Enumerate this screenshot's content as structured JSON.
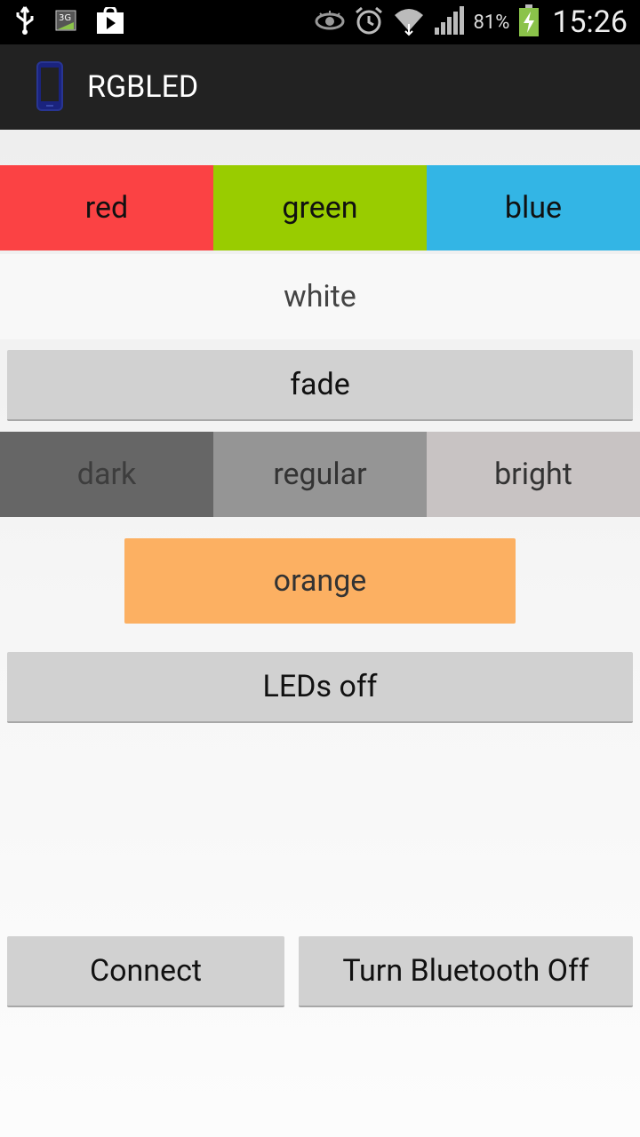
{
  "status_bar": {
    "battery_percent": "81%",
    "time": "15:26",
    "icons": [
      "usb-icon",
      "3g-icon",
      "play-store-icon",
      "eye-icon",
      "alarm-icon",
      "wifi-icon",
      "signal-icon",
      "battery-charging-icon"
    ]
  },
  "action_bar": {
    "title": "RGBLED",
    "icon": "phone-icon"
  },
  "colors": {
    "red": "#fb4244",
    "green": "#99cc00",
    "blue": "#33b5e5",
    "white": "#f8f8f8",
    "dark": "#666666",
    "regular": "#959595",
    "bright": "#c8c3c3",
    "orange": "#fcb062",
    "button": "#d1d1d1"
  },
  "color_buttons": {
    "red": "red",
    "green": "green",
    "blue": "blue",
    "white": "white",
    "fade": "fade"
  },
  "brightness": {
    "dark": "dark",
    "regular": "regular",
    "bright": "bright"
  },
  "orange": "orange",
  "leds_off": "LEDs off",
  "connect": "Connect",
  "bluetooth_off": "Turn Bluetooth Off"
}
